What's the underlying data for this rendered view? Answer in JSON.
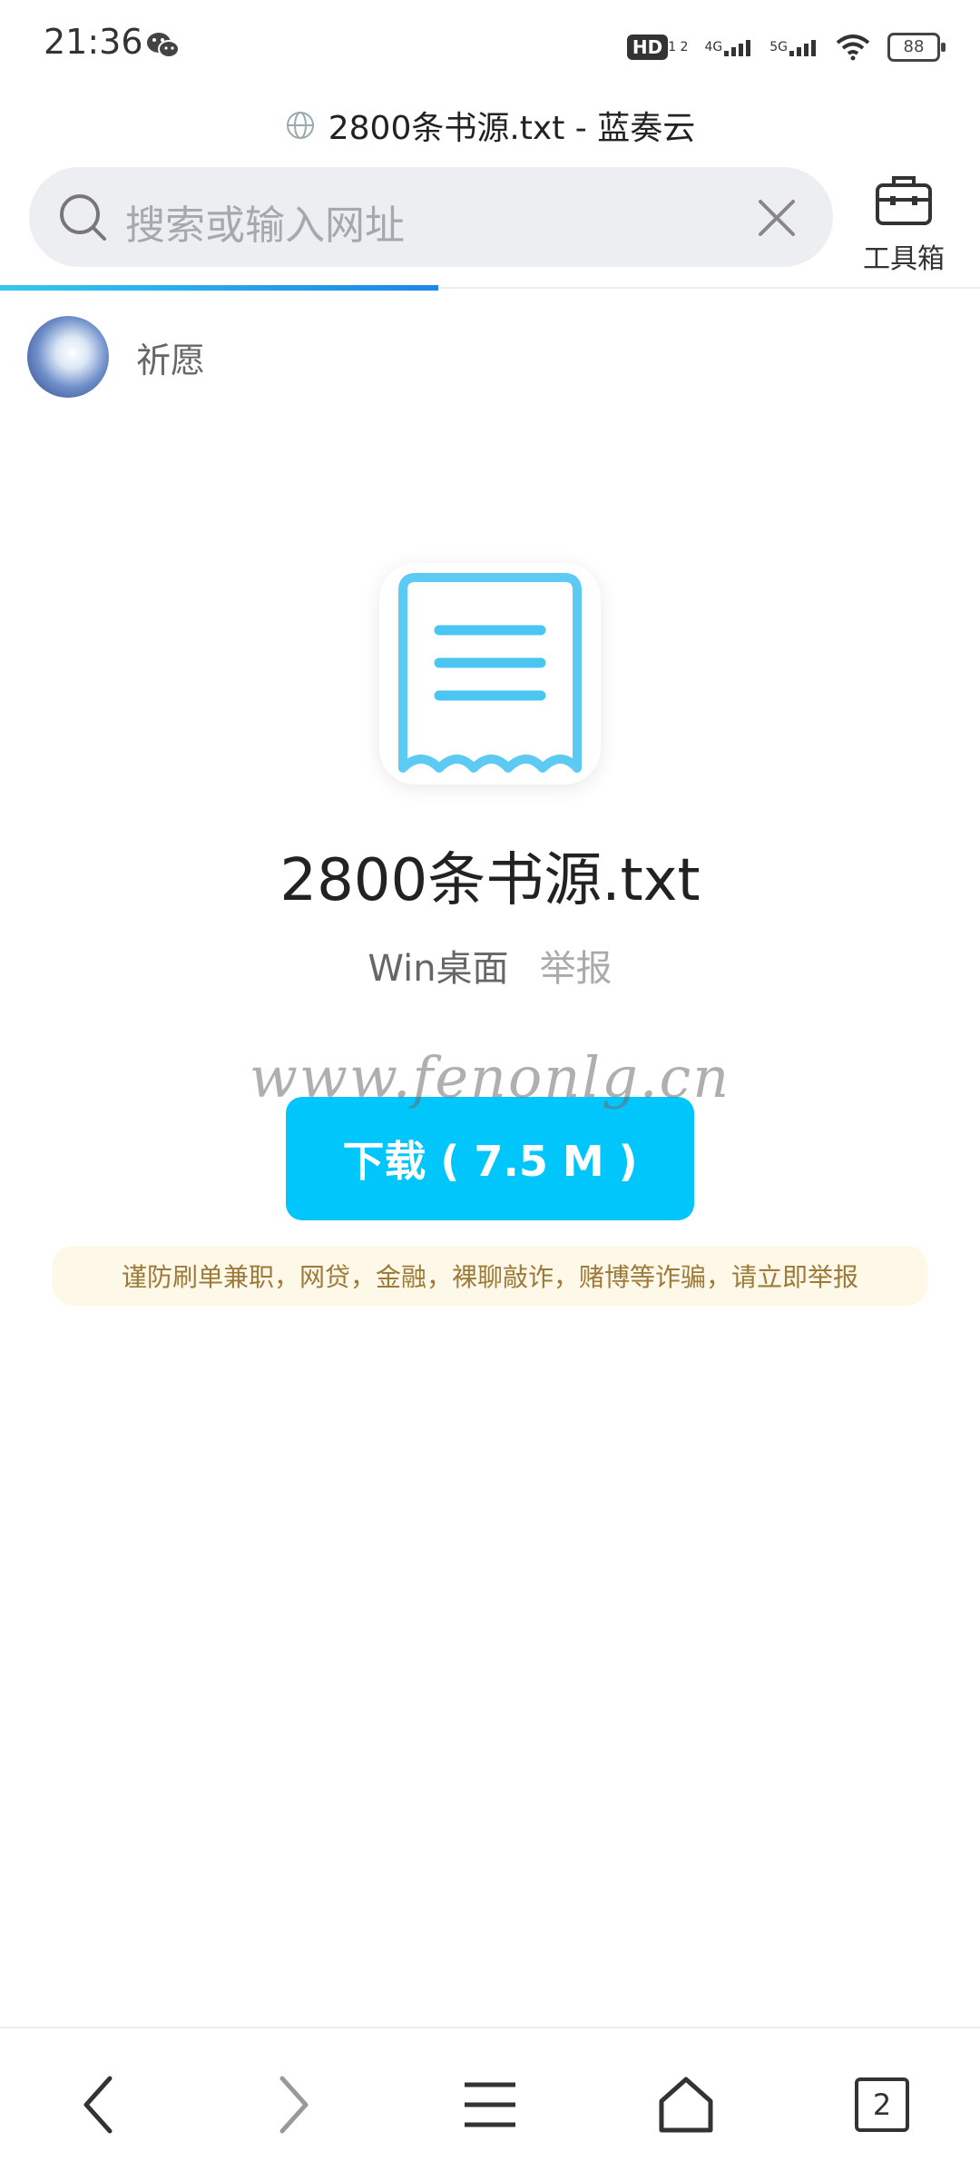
{
  "status_bar": {
    "time": "21:36",
    "hd_badge": "HD",
    "hd_sub": "1 2",
    "network_4g": "4G",
    "network_5g": "5G",
    "battery": "88"
  },
  "page": {
    "title": "2800条书源.txt - 蓝奏云"
  },
  "search": {
    "placeholder": "搜索或输入网址"
  },
  "toolbox": {
    "label": "工具箱"
  },
  "progress": {
    "fraction": 0.447
  },
  "user": {
    "name": "祈愿"
  },
  "file": {
    "name": "2800条书源.txt",
    "platform": "Win桌面",
    "report": "举报"
  },
  "watermark": "www.fenonlg.cn",
  "download": {
    "label": "下载 ( 7.5 M )"
  },
  "warning": "谨防刷单兼职，网贷，金融，裸聊敲诈，赌博等诈骗，请立即举报",
  "bottom_nav": {
    "tab_count": "2"
  },
  "colors": {
    "accent": "#00c6fb",
    "warning_bg": "#fdf8e7",
    "warning_text": "#9d7a3a",
    "file_icon": "#5ccaf2"
  }
}
